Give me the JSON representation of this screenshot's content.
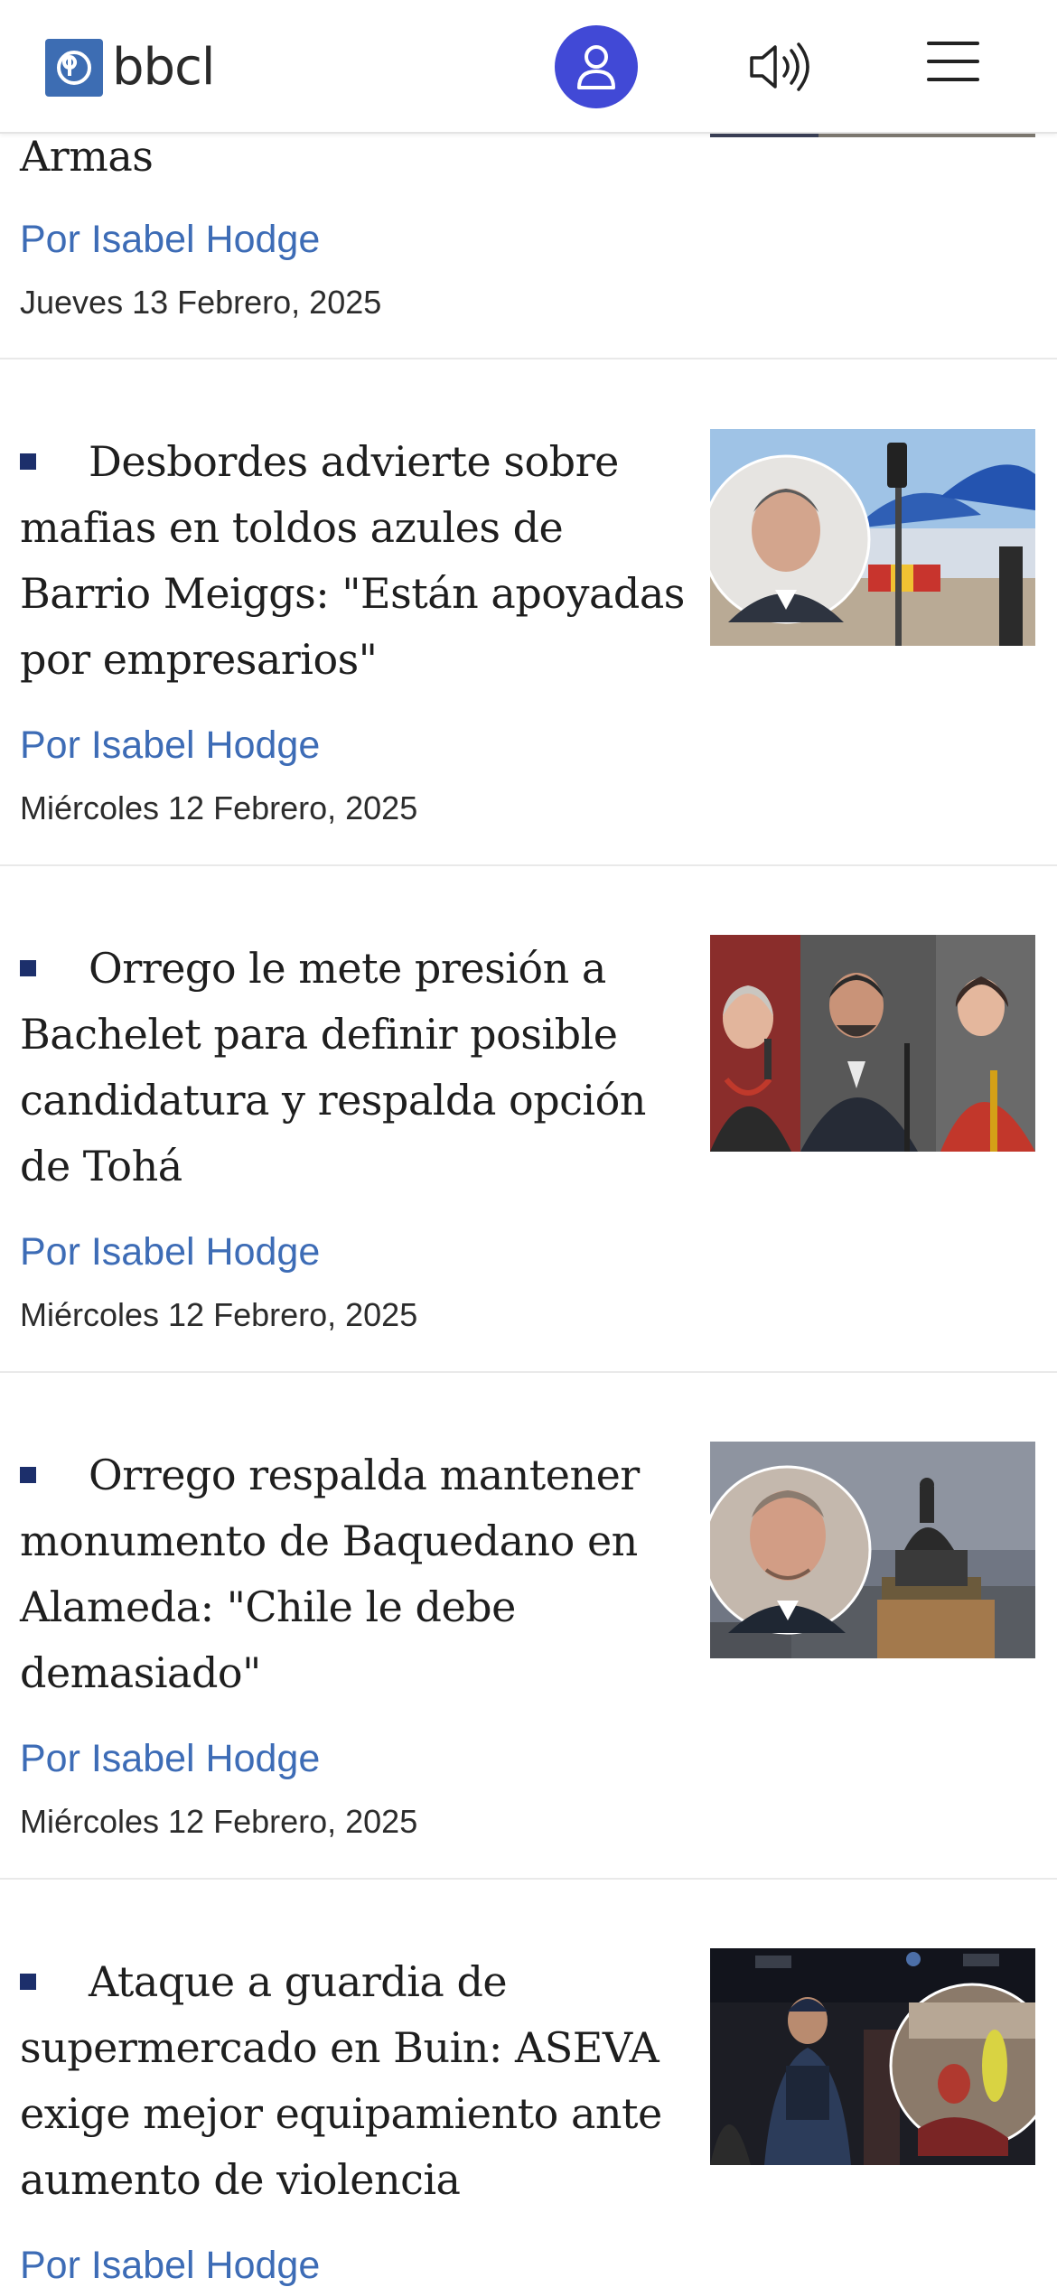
{
  "header": {
    "logo_text": "bbcl",
    "logo_icon": "bbcl-logo-icon",
    "user_icon": "user-icon",
    "audio_icon": "speaker-icon",
    "menu_icon": "hamburger-menu-icon",
    "accent_color": "#4149d6",
    "brand_color": "#3d6db3"
  },
  "articles": [
    {
      "title": "Armas",
      "author": "Por Isabel Hodge",
      "date": "Jueves 13 Febrero, 2025"
    },
    {
      "title": "Desbordes advierte sobre mafias en toldos azules de Barrio Meiggs: \"Están apoyadas por empresarios\"",
      "author": "Por Isabel Hodge",
      "date": "Miércoles 12 Febrero, 2025"
    },
    {
      "title": "Orrego le mete presión a Bachelet para definir posible candidatura y respalda opción de Tohá",
      "author": "Por Isabel Hodge",
      "date": "Miércoles 12 Febrero, 2025"
    },
    {
      "title": "Orrego respalda mantener monumento de Baquedano en Alameda: \"Chile le debe demasiado\"",
      "author": "Por Isabel Hodge",
      "date": "Miércoles 12 Febrero, 2025"
    },
    {
      "title": "Ataque a guardia de supermercado en Buin: ASEVA exige mejor equipamiento ante aumento de violencia",
      "author": "Por Isabel Hodge"
    }
  ]
}
